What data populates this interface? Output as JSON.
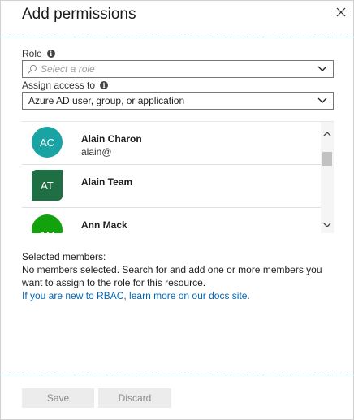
{
  "header": {
    "title": "Add permissions"
  },
  "role": {
    "label": "Role",
    "placeholder": "Select a role"
  },
  "assign": {
    "label": "Assign access to",
    "value": "Azure AD user, group, or application"
  },
  "members": [
    {
      "initials": "AC",
      "name": "Alain Charon",
      "email": "alain@",
      "color": "#1aa3a3",
      "shape": "round"
    },
    {
      "initials": "AT",
      "name": "Alain Team",
      "email": "",
      "color": "#1e6f43",
      "shape": "group"
    },
    {
      "initials": "AM",
      "name": "Ann Mack",
      "email": "",
      "color": "#13a10e",
      "shape": "round"
    }
  ],
  "selection": {
    "heading": "Selected members:",
    "message": "No members selected. Search for and add one or more members you want to assign to the role for this resource.",
    "link": "If you are new to RBAC, learn more on our docs site."
  },
  "footer": {
    "save_label": "Save",
    "discard_label": "Discard"
  },
  "colors": {
    "accent_divider": "#7bc9e0",
    "link": "#0067b8"
  }
}
